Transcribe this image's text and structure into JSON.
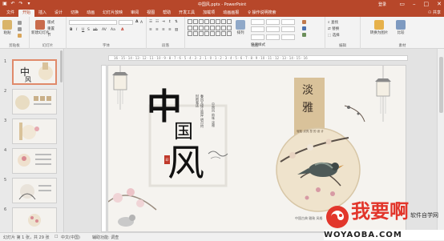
{
  "titlebar": {
    "title": "中国风.pptx - PowerPoint",
    "signin": "登录",
    "share": "共享"
  },
  "tabs": [
    "文件",
    "开始",
    "插入",
    "设计",
    "切换",
    "动画",
    "幻灯片放映",
    "审阅",
    "视图",
    "帮助",
    "开发工具",
    "加载项",
    "动画画报"
  ],
  "active_tab": 1,
  "tell_me": "操作说明搜索",
  "ribbon": {
    "groups": [
      "剪贴板",
      "幻灯片",
      "字体",
      "段落",
      "绘图",
      "编辑",
      "素材"
    ],
    "paste": "粘贴",
    "new_slide": "新建幻灯片",
    "layout": "版式",
    "reset": "重置",
    "section": "节",
    "arrange": "排列",
    "quick_styles": "快速样式",
    "find": "查找",
    "replace": "替换",
    "select": "选择",
    "convert": "转换为图片",
    "compare": "比较"
  },
  "ruler": "16 · 15 · 14 · 13 · 12 · 11 · 10 · 9 · 8 · 7 · 6 · 5 · 4 · 3 · 2 · 1 · 0 · 1 · 2 · 3 · 4 · 5 · 6 · 7 · 8 · 9 · 10 · 11 · 12 · 13 · 14 · 15 · 16",
  "slide_numbers": [
    "1",
    "2",
    "3",
    "4",
    "5",
    "6"
  ],
  "slide": {
    "big_char_1": "中",
    "big_char_2": "国",
    "big_char_3": "风",
    "tag_1": "淡",
    "tag_2": "雅",
    "tag_sub": "轻松 点亮 您 的 设 计",
    "poem": "春风又绿江南岸 明月何时照我还",
    "poem_2": "中国风 韵味 淡雅",
    "bottom_caption": "中国古典 雅致 风格",
    "seal": "印"
  },
  "status": {
    "slide_info": "幻灯片 第 1 张，共 29 张",
    "language": "中文(中国)",
    "accessibility": "辅助功能: 调查"
  },
  "watermark": {
    "text": "我要啊",
    "domain": "WOYAOBA.COM",
    "extra": "软件自学网"
  },
  "colors": {
    "accent": "#b7472a",
    "tag_bg": "#d9c29a",
    "circle": "#efe3cc"
  }
}
